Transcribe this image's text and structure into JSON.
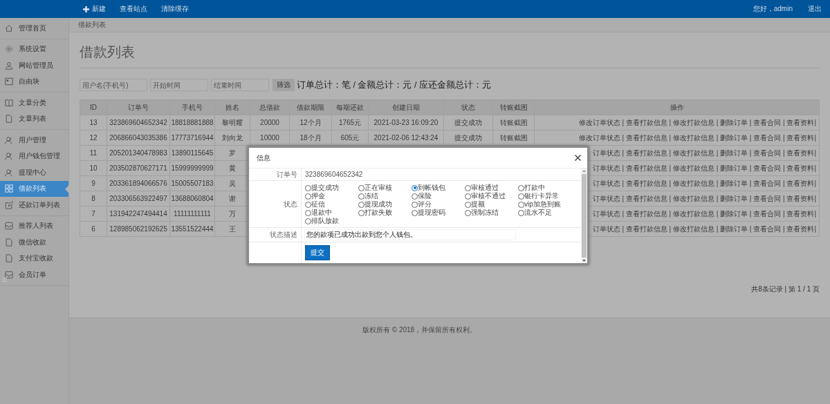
{
  "header": {
    "links": [
      {
        "label": "新建",
        "kind": "new"
      },
      {
        "label": "查看站点",
        "kind": "plain"
      },
      {
        "label": "清除缓存",
        "kind": "plain"
      }
    ],
    "greeting": "您好，admin",
    "logout": "退出"
  },
  "sidebar": {
    "groups": [
      {
        "items": [
          {
            "label": "管理首页",
            "selected": false
          }
        ]
      },
      {
        "items": [
          {
            "label": "系统设置",
            "selected": false
          },
          {
            "label": "网站管理员",
            "selected": false
          },
          {
            "label": "自由块",
            "selected": false
          }
        ]
      },
      {
        "items": [
          {
            "label": "文章分类",
            "selected": false
          },
          {
            "label": "文章列表",
            "selected": false
          }
        ]
      },
      {
        "items": [
          {
            "label": "用户管理",
            "selected": false
          },
          {
            "label": "用户钱包管理",
            "selected": false
          },
          {
            "label": "提现中心",
            "selected": false
          },
          {
            "label": "借款列表",
            "selected": true
          },
          {
            "label": "还款订单列表",
            "selected": false
          }
        ]
      },
      {
        "items": [
          {
            "label": "推荐人列表",
            "selected": false
          },
          {
            "label": "微信收款",
            "selected": false
          },
          {
            "label": "支付宝收款",
            "selected": false
          },
          {
            "label": "会员订单",
            "selected": false
          }
        ]
      }
    ]
  },
  "breadcrumb": "借款列表",
  "page_title": "借款列表",
  "filters": {
    "fields": [
      {
        "placeholder": "用户名(手机号)"
      },
      {
        "placeholder": "开始时间"
      },
      {
        "placeholder": "结束时间"
      }
    ],
    "button": "筛选",
    "summary": "订单总计：笔 / 金额总计：元 / 应还金额总计：元"
  },
  "table": {
    "columns": [
      "ID",
      "订单号",
      "手机号",
      "姓名",
      "总借款",
      "借款期限",
      "每期还款",
      "创建日期",
      "状态",
      "转账截图",
      "操作"
    ],
    "rows": [
      {
        "id": "13",
        "order_no": "323869604652342",
        "phone": "18818881888",
        "name": "黎明耀",
        "total": "20000",
        "term": "12个月",
        "installment": "1765元",
        "created": "2021-03-23 16:09:20",
        "status": "提交成功",
        "screenshot": "转账截图",
        "actions": "修改订单状态 | 查看打款信息 | 修改打款信息 | 删除订单 | 查看合同 | 查看资料|"
      },
      {
        "id": "12",
        "order_no": "206866043035386",
        "phone": "17773716944",
        "name": "刘向龙",
        "total": "10000",
        "term": "18个月",
        "installment": "605元",
        "created": "2021-02-06 12:43:24",
        "status": "提交成功",
        "screenshot": "转账截图",
        "actions": "修改订单状态 | 查看打款信息 | 修改打款信息 | 删除订单 | 查看合同 | 查看资料|"
      },
      {
        "id": "11",
        "order_no": "205201340478983",
        "phone": "13890115645",
        "name": "罗",
        "actions": "订单状态 | 查看打款信息 | 修改打款信息 | 删除订单 | 查看合同 | 查看资料|"
      },
      {
        "id": "10",
        "order_no": "203502870627171",
        "phone": "15999999999",
        "name": "黄",
        "actions": "订单状态 | 查看打款信息 | 修改打款信息 | 删除订单 | 查看合同 | 查看资料|"
      },
      {
        "id": "9",
        "order_no": "203361894066576",
        "phone": "15005507183",
        "name": "吴",
        "actions": "订单状态 | 查看打款信息 | 修改打款信息 | 删除订单 | 查看合同 | 查看资料|"
      },
      {
        "id": "8",
        "order_no": "203306563922497",
        "phone": "13688060804",
        "name": "谢",
        "actions": "订单状态 | 查看打款信息 | 修改打款信息 | 删除订单 | 查看合同 | 查看资料|"
      },
      {
        "id": "7",
        "order_no": "131942247494414",
        "phone": "11111111111",
        "name": "万",
        "actions": "订单状态 | 查看打款信息 | 修改打款信息 | 删除订单 | 查看合同 | 查看资料|"
      },
      {
        "id": "6",
        "order_no": "128985062192625",
        "phone": "13551522444",
        "name": "王",
        "actions": "订单状态 | 查看打款信息 | 修改打款信息 | 删除订单 | 查看合同 | 查看资料|"
      }
    ]
  },
  "pagination": "共8条记录 | 第 1 / 1 页",
  "footer": "版权所有 © 2018，并保留所有权利。",
  "modal": {
    "title": "信息",
    "order_label": "订单号",
    "order_no": "323869604652342",
    "status_label": "状态",
    "options": [
      {
        "label": "提交成功",
        "selected": false
      },
      {
        "label": "正在审核",
        "selected": false
      },
      {
        "label": "到帐钱包",
        "selected": true
      },
      {
        "label": "审核通过",
        "selected": false
      },
      {
        "label": "打款中",
        "selected": false
      },
      {
        "label": "押金",
        "selected": false
      },
      {
        "label": "冻结",
        "selected": false
      },
      {
        "label": "保险",
        "selected": false
      },
      {
        "label": "审核不通过",
        "selected": false
      },
      {
        "label": "银行卡异常",
        "selected": false
      },
      {
        "label": "征信",
        "selected": false
      },
      {
        "label": "提现成功",
        "selected": false
      },
      {
        "label": "评分",
        "selected": false
      },
      {
        "label": "提额",
        "selected": false
      },
      {
        "label": "vip加急到账",
        "selected": false
      },
      {
        "label": "退款中",
        "selected": false
      },
      {
        "label": "打款失败",
        "selected": false
      },
      {
        "label": "提现密码",
        "selected": false
      },
      {
        "label": "强制冻结",
        "selected": false
      },
      {
        "label": "流水不足",
        "selected": false
      },
      {
        "label": "排队放款",
        "selected": false
      }
    ],
    "desc_label": "状态描述",
    "desc_value": "您的款项已成功出款到您个人钱包。",
    "submit": "提交"
  }
}
